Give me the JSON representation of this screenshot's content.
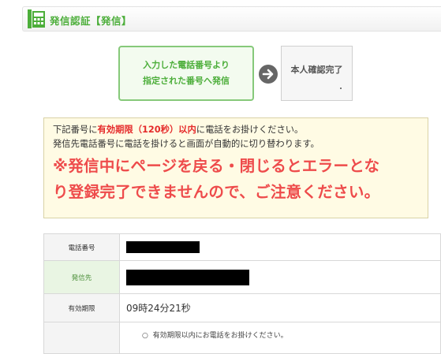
{
  "header": {
    "title": "発信認証【発信】",
    "icon": "phone-icon"
  },
  "steps": {
    "step1_line1": "入力した電話番号より",
    "step1_line2": "指定された番号へ発信",
    "arrow_icon": "arrow-right-circle-icon",
    "step2_label": "本人確認完了"
  },
  "notice": {
    "line1_pre": "下記番号に",
    "line1_em": "有効期限（120秒）以内",
    "line1_post": "に電話をお掛けください。",
    "line2": "発信先電話番号に電話を掛けると画面が自動的に切り替わります。",
    "warning_line1": "※発信中にページを戻る・閉じるとエラーとな",
    "warning_line2": "り登録完了できませんので、ご注意ください。"
  },
  "table": {
    "rows": [
      {
        "label": "電話番号",
        "value": ""
      },
      {
        "label": "発信先",
        "value": ""
      },
      {
        "label": "有効期限",
        "value": "09時24分21秒"
      }
    ],
    "bullet": "有効期限以内にお電話をお掛けください。"
  },
  "colors": {
    "accent_green": "#4cae3a",
    "warning_red": "#ee4b4b",
    "notice_bg": "#fffbe4"
  }
}
